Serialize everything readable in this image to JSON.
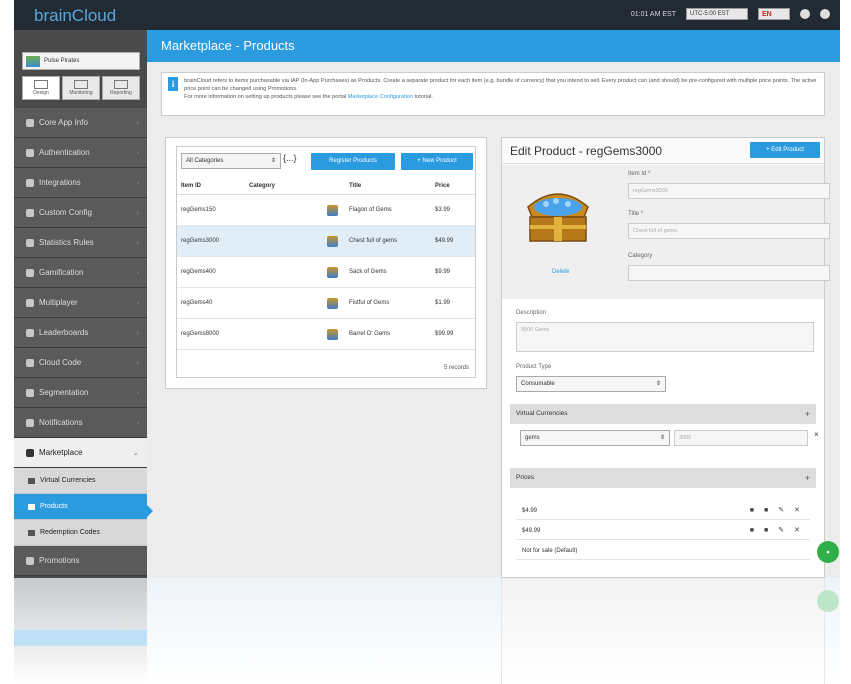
{
  "app": {
    "brand": "brainCloud",
    "server_time": "01:01 AM EST",
    "timezone": "UTC-5:00 EST",
    "language": "EN"
  },
  "sidebar": {
    "selected_app": "Pulse Pirates",
    "tools": [
      "Design",
      "Monitoring",
      "Reporting"
    ],
    "items": [
      {
        "label": "Core App Info"
      },
      {
        "label": "Authentication"
      },
      {
        "label": "Integrations"
      },
      {
        "label": "Custom Config"
      },
      {
        "label": "Statistics Rules"
      },
      {
        "label": "Gamification"
      },
      {
        "label": "Multiplayer"
      },
      {
        "label": "Leaderboards"
      },
      {
        "label": "Cloud Code"
      },
      {
        "label": "Segmentation"
      },
      {
        "label": "Notifications"
      },
      {
        "label": "Marketplace"
      }
    ],
    "sub_items": [
      {
        "label": "Virtual Currencies"
      },
      {
        "label": "Products"
      },
      {
        "label": "Redemption Codes"
      }
    ],
    "last_item": "Promotions"
  },
  "header": {
    "title": "Marketplace - Products"
  },
  "info": {
    "text1": "brainCloud refers to items purchasable via IAP (In-App Purchases) as Products. Create a separate product for each item (e.g. bundle of currency) that you intend to sell. Every product can (and should) be pre-configured with multiple price points. The active price point can be changed using Promotions.",
    "text2": "For more information on setting up products please see the portal ",
    "link": "Marketplace Configuration",
    "text3": " tutorial."
  },
  "list": {
    "category_filter": "All Categories",
    "braces": "{...}",
    "register_button": "Register Products",
    "new_button": "+ New Product",
    "columns": [
      "Item ID",
      "Category",
      "Title",
      "Price"
    ],
    "rows": [
      {
        "id": "regGems150",
        "category": "",
        "title": "Flagon of Gems",
        "price": "$3.99"
      },
      {
        "id": "regGems3000",
        "category": "",
        "title": "Chest full of gems",
        "price": "$49.99"
      },
      {
        "id": "regGems400",
        "category": "",
        "title": "Sack of Gems",
        "price": "$9.99"
      },
      {
        "id": "regGems40",
        "category": "",
        "title": "Fistful of Gems",
        "price": "$1.99"
      },
      {
        "id": "regGems8000",
        "category": "",
        "title": "Barrel O' Gems",
        "price": "$99.99"
      }
    ],
    "footer": "5 records"
  },
  "edit": {
    "title": "Edit Product - regGems3000",
    "edit_button": "+ Edit Product",
    "delete_link": "Delete",
    "item_id_label": "Item Id *",
    "item_id_value": "regGems3000",
    "title_label": "Title *",
    "title_value": "Chest full of gems",
    "category_label": "Category",
    "category_value": "",
    "description_label": "Description",
    "description_value": "3000 Gems",
    "product_type_label": "Product Type",
    "product_type_value": "Consumable",
    "virtual_currencies_label": "Virtual Currencies",
    "currency_value": "gems",
    "currency_amount": "3000",
    "prices_label": "Prices",
    "prices": [
      "$4.99",
      "$49.99"
    ],
    "not_for_sale": "Not for sale (Default)"
  }
}
